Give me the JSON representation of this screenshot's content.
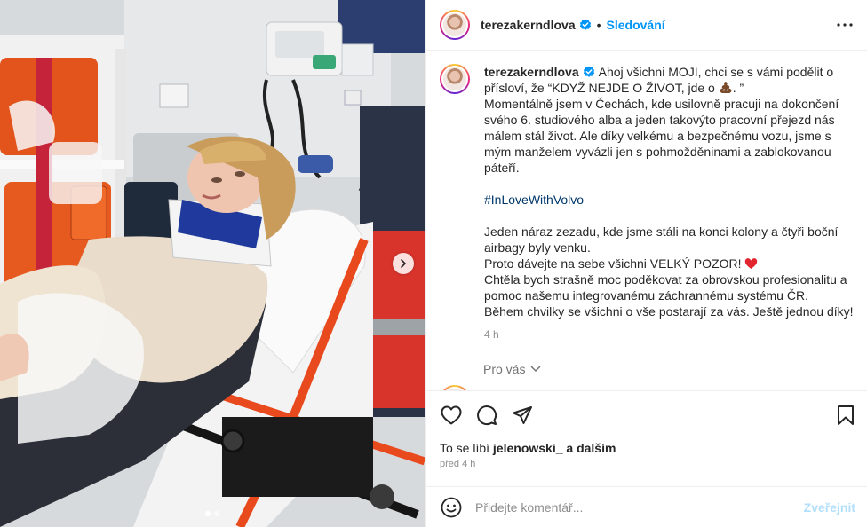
{
  "post": {
    "username": "terezakerndlova",
    "follow_label": "Sledování",
    "separator": "•",
    "caption": {
      "line1": "Ahoj všichni MOJI, chci se s vámi podělit o přísloví, že “KDYŽ NEJDE O ŽIVOT, jde o",
      "line1_end": ". ”",
      "paragraph1": "Momentálně jsem v Čechách, kde usilovně pracuji na dokončení svého 6. studiového alba a jeden takovýto pracovní přejezd nás málem stál život. Ale díky velkému a bezpečnému vozu, jsme s mým manželem vyvázli jen s pohmožděninami a zablokovanou páteří.",
      "hashtag": "#InLoveWithVolvo",
      "paragraph2": "Jeden náraz zezadu, kde jsme stáli na konci kolony a čtyři boční airbagy byly venku.",
      "paragraph3": "Proto dávejte na sebe všichni VELKÝ POZOR!",
      "paragraph4": "Chtěla bych strašně moc poděkovat za obrovskou profesionalitu a pomoc našemu integrovanému záchrannému systému ČR.",
      "paragraph5": "Během chvilky se všichni o vše postarají za vás. Ještě jednou díky!"
    },
    "caption_time": "4 h",
    "for_you_label": "Pro vás",
    "likes": {
      "prefix": "To se líbí",
      "user": "jelenowski_",
      "suffix": "a dalším"
    },
    "posted_ago": "před 4 h",
    "comment": {
      "placeholder": "Přidejte komentář...",
      "post_label": "Zveřejnit"
    },
    "carousel": {
      "slide_count": 2,
      "active_slide": 1
    }
  },
  "colors": {
    "accent": "#0095f6",
    "hashtag": "#00376b",
    "muted": "#8e8e8e",
    "border": "#efefef",
    "heart": "#ed4956"
  },
  "icons": [
    "verified-badge-icon",
    "more-options-icon",
    "like-icon",
    "comment-icon",
    "share-icon",
    "save-icon",
    "emoji-icon",
    "chevron-right-icon",
    "chevron-down-icon",
    "red-heart-emoji",
    "poo-emoji"
  ]
}
